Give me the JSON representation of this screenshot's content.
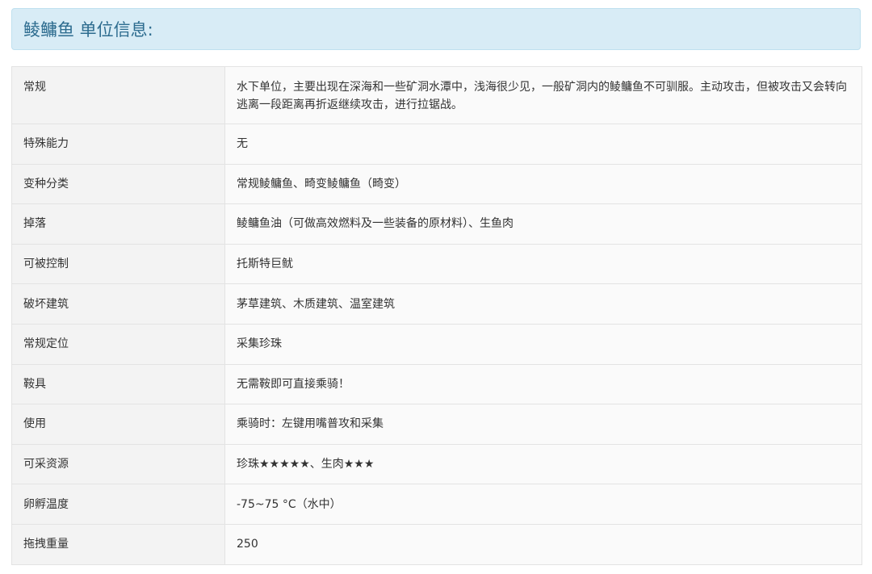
{
  "header": {
    "title": "鲮鳙鱼 单位信息:"
  },
  "rows": [
    {
      "key": "常规",
      "value": "水下单位，主要出现在深海和一些矿洞水潭中，浅海很少见，一般矿洞内的鲮鳙鱼不可驯服。主动攻击，但被攻击又会转向逃离一段距离再折返继续攻击，进行拉锯战。"
    },
    {
      "key": "特殊能力",
      "value": "无"
    },
    {
      "key": "变种分类",
      "value": "常规鲮鳙鱼、畸变鲮鳙鱼（畸变）"
    },
    {
      "key": "掉落",
      "value": "鲮鳙鱼油（可做高效燃料及一些装备的原材料）、生鱼肉"
    },
    {
      "key": "可被控制",
      "value": "托斯特巨鱿"
    },
    {
      "key": "破坏建筑",
      "value": "茅草建筑、木质建筑、温室建筑"
    },
    {
      "key": "常规定位",
      "value": "采集珍珠"
    },
    {
      "key": "鞍具",
      "value": "无需鞍即可直接乘骑！"
    },
    {
      "key": "使用",
      "value": "乘骑时：左键用嘴普攻和采集"
    },
    {
      "key": "可采资源",
      "value": "珍珠★★★★★、生肉★★★"
    },
    {
      "key": "卵孵温度",
      "value": "-75~75 °C（水中）"
    },
    {
      "key": "拖拽重量",
      "value": "250"
    }
  ]
}
